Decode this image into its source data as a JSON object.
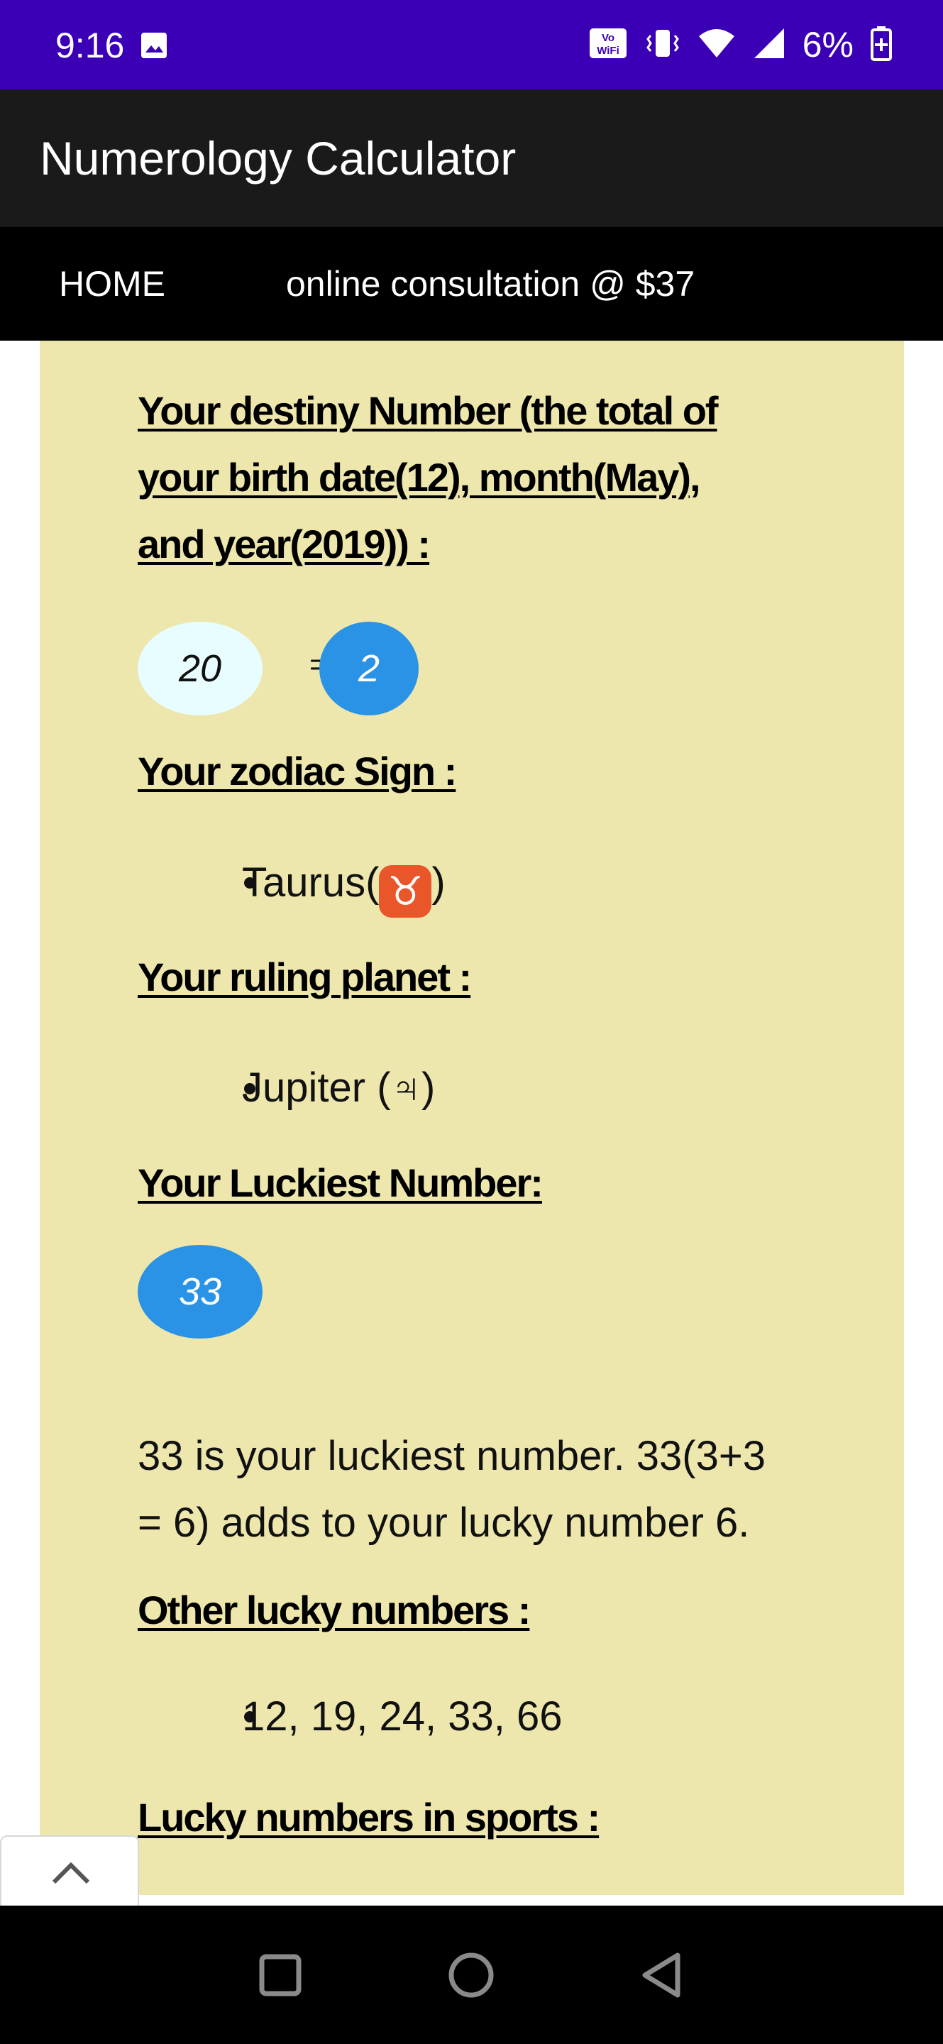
{
  "status_bar": {
    "time": "9:16",
    "battery": "6%",
    "icons": [
      "gallery-icon",
      "vowifi-icon",
      "vibrate-icon",
      "wifi-icon",
      "signal-icon",
      "battery-icon"
    ]
  },
  "app_bar": {
    "title": "Numerology Calculator"
  },
  "nav": {
    "home": "HOME",
    "consultation": "online consultation @ $37"
  },
  "destiny": {
    "heading_line1": "Your destiny Number (the total of",
    "heading_line2": "your birth date(12), month(May),",
    "heading_line3": "and year(2019)) :",
    "total": "20",
    "arrow": "=>",
    "reduced": "2"
  },
  "zodiac": {
    "heading": "Your zodiac Sign :",
    "sign": "Taurus(",
    "symbol": "♉",
    "close": ")"
  },
  "planet": {
    "heading": "Your ruling planet :",
    "value": "Jupiter (♃)"
  },
  "lucky": {
    "heading": "Your Luckiest Number:",
    "number": "33",
    "description_line1": "33 is your luckiest number. 33(3+3",
    "description_line2": "= 6) adds to your lucky number 6."
  },
  "other_lucky": {
    "heading": "Other lucky numbers :",
    "values": "12, 19, 24, 33, 66"
  },
  "sports": {
    "heading": "Lucky numbers in sports :"
  },
  "colors": {
    "status_bar": "#3b00b6",
    "card_background": "#ede7ad",
    "bubble_blue": "#2b93e6",
    "bubble_light": "#e8fdff"
  }
}
